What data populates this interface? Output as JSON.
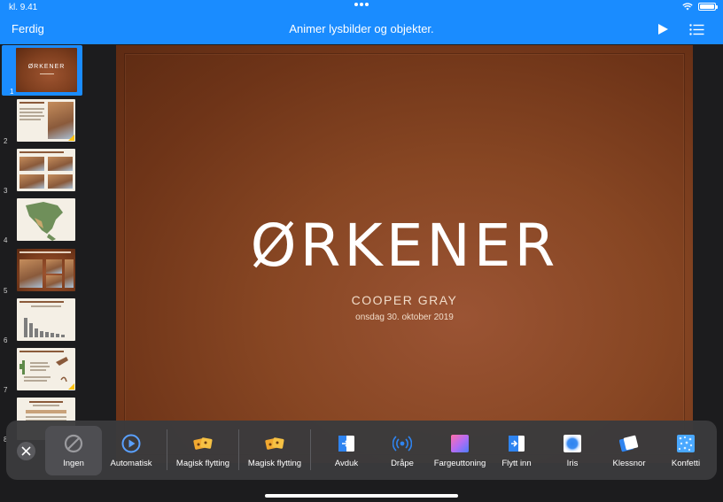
{
  "status_bar": {
    "time": "kl. 9.41"
  },
  "nav_bar": {
    "done_label": "Ferdig",
    "title": "Animer lysbilder og objekter."
  },
  "navigator": {
    "slides": [
      {
        "number": "1",
        "thumb_title": "ØRKENER",
        "selected": true
      },
      {
        "number": "2"
      },
      {
        "number": "3"
      },
      {
        "number": "4"
      },
      {
        "number": "5"
      },
      {
        "number": "6"
      },
      {
        "number": "7"
      },
      {
        "number": "8"
      }
    ]
  },
  "slide": {
    "title": "ØRKENER",
    "author": "COOPER GRAY",
    "date": "onsdag 30. oktober 2019"
  },
  "effects": [
    {
      "label": "Ingen",
      "icon": "none-icon",
      "selected": true
    },
    {
      "label": "Automatisk",
      "icon": "auto-play-icon"
    },
    {
      "label": "Magisk flytting",
      "icon": "magic-move-icon"
    },
    {
      "label": "Magisk flytting",
      "icon": "magic-move-icon"
    },
    {
      "label": "Avduk",
      "icon": "reveal-icon"
    },
    {
      "label": "Dråpe",
      "icon": "droplet-icon"
    },
    {
      "label": "Fargeuttoning",
      "icon": "color-fade-icon"
    },
    {
      "label": "Flytt inn",
      "icon": "move-in-icon"
    },
    {
      "label": "Iris",
      "icon": "iris-icon"
    },
    {
      "label": "Klessnor",
      "icon": "clothesline-icon"
    },
    {
      "label": "Konfetti",
      "icon": "confetti-icon"
    }
  ],
  "colors": {
    "accent": "#1a8cff",
    "highlight": "#ffc20e",
    "slide_background": "#874623"
  }
}
